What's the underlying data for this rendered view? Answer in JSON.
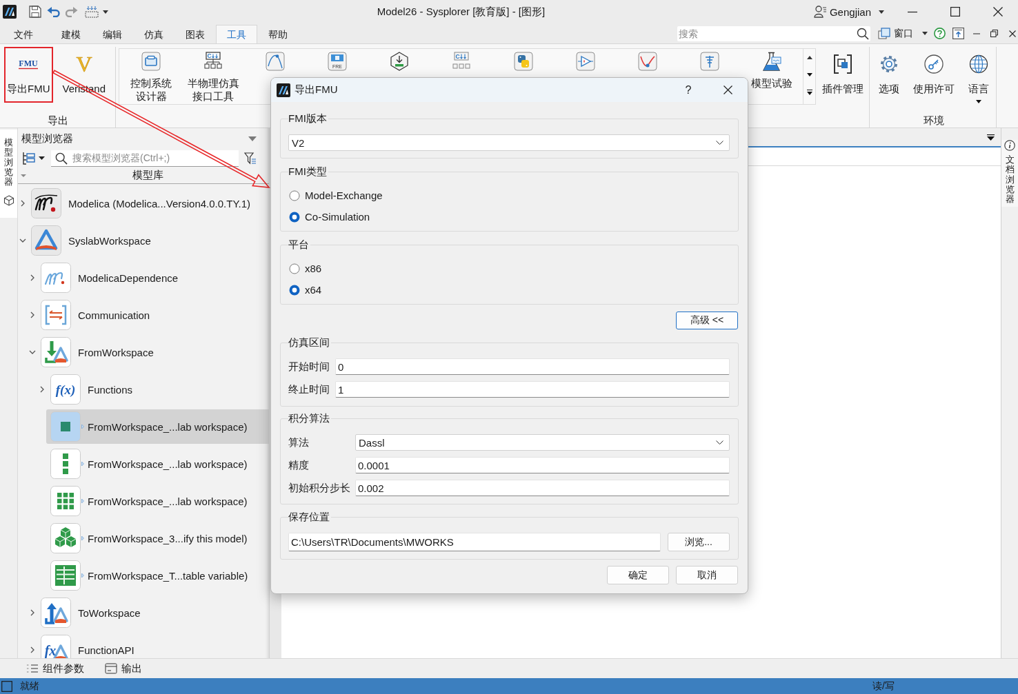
{
  "window": {
    "title": "Model26 - Sysplorer [教育版] - [图形]",
    "user": "Gengjian"
  },
  "menu": {
    "tabs": [
      {
        "label": "文件",
        "selected": false
      },
      {
        "label": "建模",
        "selected": false
      },
      {
        "label": "编辑",
        "selected": false
      },
      {
        "label": "仿真",
        "selected": false
      },
      {
        "label": "图表",
        "selected": false
      },
      {
        "label": "工具",
        "selected": true
      },
      {
        "label": "帮助",
        "selected": false
      }
    ],
    "search_placeholder": "搜索",
    "window_menu": "窗口"
  },
  "ribbon": {
    "export_group": {
      "label": "导出",
      "buttons": [
        {
          "kind": "fmu",
          "icon_text": "FMU",
          "label": "导出FMU",
          "annotated": true
        },
        {
          "kind": "veristand",
          "icon_text": "V",
          "label": "Veristand",
          "annotated": false
        }
      ]
    },
    "gallery": [
      {
        "kind": "designer",
        "lines": [
          "控制系统",
          "设计器"
        ]
      },
      {
        "kind": "hil",
        "icon_text": "C",
        "lines": [
          "半物理仿真",
          "接口工具"
        ]
      },
      {
        "kind": "curve"
      },
      {
        "kind": "fre",
        "icon_text": "FRE"
      },
      {
        "kind": "download"
      },
      {
        "kind": "codegen",
        "icon_text": "C"
      },
      {
        "kind": "python"
      },
      {
        "kind": "amplifier"
      },
      {
        "kind": "response"
      },
      {
        "kind": "filter"
      },
      {
        "kind": "flask",
        "lines": [
          "模型试验"
        ]
      }
    ],
    "plugin": {
      "label": "插件管理"
    },
    "environment": {
      "label": "环境",
      "buttons": [
        {
          "kind": "gear",
          "label": "选项",
          "dropdown": false
        },
        {
          "kind": "key",
          "label": "使用许可",
          "dropdown": false
        },
        {
          "kind": "globe",
          "label": "语言",
          "dropdown": true
        }
      ]
    }
  },
  "side_tabs": {
    "left": "模型浏览器",
    "right": "文档浏览器"
  },
  "model_browser": {
    "title": "模型浏览器",
    "search_placeholder": "搜索模型浏览器(Ctrl+;)",
    "column": "模型库",
    "tree": [
      {
        "label": "Modelica (Modelica...Version4.0.0.TY.1)",
        "kind": "library",
        "expanded": false,
        "selected": false
      },
      {
        "label": "SyslabWorkspace",
        "kind": "workspace",
        "expanded": true,
        "selected": false,
        "children": [
          {
            "label": "ModelicaDependence",
            "kind": "dependence",
            "expanded": false,
            "selected": false
          },
          {
            "label": "Communication",
            "kind": "comm",
            "expanded": false,
            "selected": false
          },
          {
            "label": "FromWorkspace",
            "kind": "from",
            "expanded": true,
            "selected": false,
            "children": [
              {
                "label": "Functions",
                "kind": "functions",
                "icon_text": "f(x)",
                "expanded": false,
                "selected": false
              },
              {
                "label": "FromWorkspace_...lab workspace)",
                "kind": "block-single",
                "selected": true
              },
              {
                "label": "FromWorkspace_...lab workspace)",
                "kind": "block-column",
                "selected": false
              },
              {
                "label": "FromWorkspace_...lab workspace)",
                "kind": "block-grid",
                "selected": false
              },
              {
                "label": "FromWorkspace_3...ify this model)",
                "kind": "block-cubes",
                "selected": false
              },
              {
                "label": "FromWorkspace_T...table variable)",
                "kind": "block-table",
                "selected": false
              }
            ]
          },
          {
            "label": "ToWorkspace",
            "kind": "to",
            "expanded": false,
            "selected": false
          },
          {
            "label": "FunctionAPI",
            "kind": "funcapi",
            "icon_text": "fx",
            "expanded": false,
            "selected": false
          }
        ]
      }
    ]
  },
  "bottom_tabs": [
    {
      "kind": "list",
      "label": "组件参数"
    },
    {
      "kind": "output",
      "label": "输出"
    }
  ],
  "status_bar": {
    "message": "就绪",
    "mode": "读/写"
  },
  "dialog": {
    "title": "导出FMU",
    "help": "?",
    "fmi_version": {
      "label": "FMI版本",
      "value": "V2"
    },
    "fmi_type": {
      "label": "FMI类型",
      "options": [
        {
          "label": "Model-Exchange",
          "selected": false
        },
        {
          "label": "Co-Simulation",
          "selected": true
        }
      ]
    },
    "platform": {
      "label": "平台",
      "options": [
        {
          "label": "x86",
          "selected": false
        },
        {
          "label": "x64",
          "selected": true
        }
      ]
    },
    "advanced_button": "高级 <<",
    "sim_interval": {
      "label": "仿真区间",
      "fields": [
        {
          "label": "开始时间",
          "value": "0"
        },
        {
          "label": "终止时间",
          "value": "1"
        }
      ]
    },
    "integration": {
      "label": "积分算法",
      "fields": [
        {
          "kind": "select",
          "label": "算法",
          "value": "Dassl"
        },
        {
          "kind": "input",
          "label": "精度",
          "value": "0.0001"
        },
        {
          "kind": "input",
          "label": "初始积分步长",
          "value": "0.002"
        }
      ]
    },
    "save_location": {
      "label": "保存位置",
      "value": "C:\\Users\\TR\\Documents\\MWORKS",
      "browse_button": "浏览..."
    },
    "buttons": [
      "确定",
      "取消"
    ]
  }
}
